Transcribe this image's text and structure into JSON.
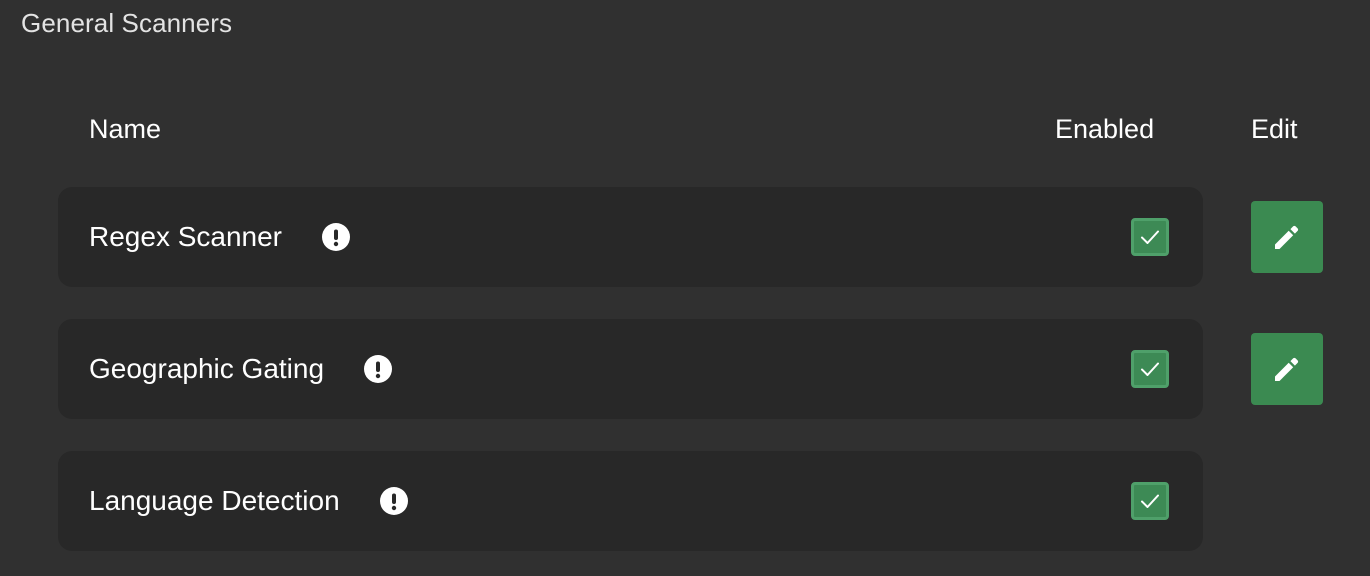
{
  "section": {
    "title": "General Scanners"
  },
  "table": {
    "headers": {
      "name": "Name",
      "enabled": "Enabled",
      "edit": "Edit"
    },
    "rows": [
      {
        "name": "Regex Scanner",
        "enabled": true,
        "has_edit": true,
        "info_icon": "exclamation-circle-icon",
        "edit_icon": "pencil-icon"
      },
      {
        "name": "Geographic Gating",
        "enabled": true,
        "has_edit": true,
        "info_icon": "exclamation-circle-icon",
        "edit_icon": "pencil-icon"
      },
      {
        "name": "Language Detection",
        "enabled": true,
        "has_edit": false,
        "info_icon": "exclamation-circle-icon"
      }
    ]
  },
  "colors": {
    "background": "#303030",
    "row_background": "#282828",
    "accent_green": "#3b8a51",
    "checkbox_border": "#4fa06a"
  }
}
